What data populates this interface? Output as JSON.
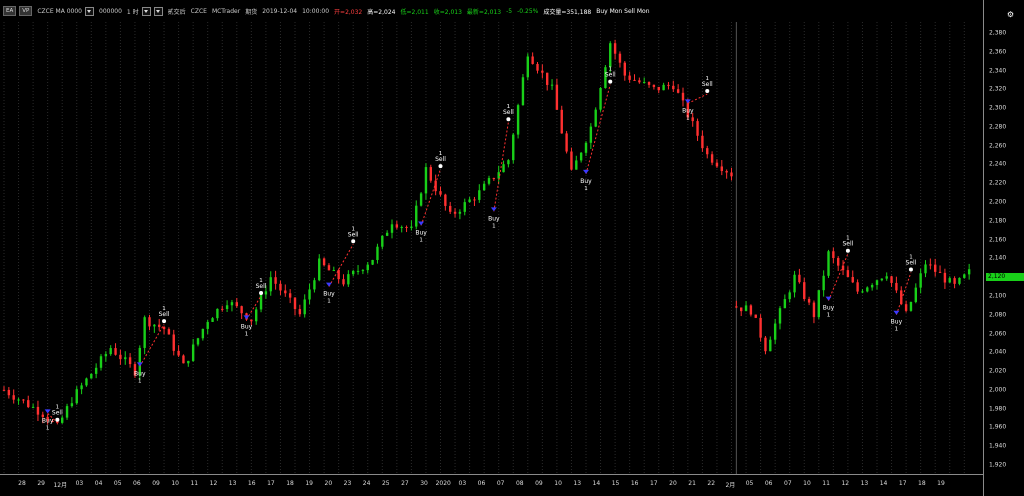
{
  "toolbar": {
    "tab": "EA",
    "vp": "VP",
    "symbol": "CZCE MA 0000",
    "preset": "000000",
    "interval": "1 时",
    "label1": "贰交后",
    "exchange": "CZCE",
    "source": "MCTrader",
    "timeframe": "期货",
    "date": "2019-12-04",
    "time": "10:00:00",
    "open": "开=2,032",
    "high": "高=2,024",
    "low": "低=2,011",
    "close": "收=2,013",
    "change_label": "最新=2,013",
    "change": "-5",
    "pct": "-0.25%",
    "volume": "成交量=351,188",
    "strategy": "Buy Mon Sell Mon"
  },
  "panel": {
    "gear_icon": "⚙",
    "last_price": "2,120"
  },
  "colors": {
    "up": "#19d019",
    "down": "#ff3030",
    "buy": "#3a3aff",
    "sell": "#ffffff"
  },
  "chart_data": {
    "type": "candlestick",
    "y_axis": {
      "ticks": [
        "2,380",
        "2,360",
        "2,340",
        "2,320",
        "2,300",
        "2,280",
        "2,260",
        "2,240",
        "2,220",
        "2,200",
        "2,180",
        "2,160",
        "2,140",
        "2,120",
        "2,100",
        "2,080",
        "2,060",
        "2,040",
        "2,020",
        "2,000",
        "1,980",
        "1,960",
        "1,940",
        "1,920"
      ],
      "range": [
        1910,
        2390
      ]
    },
    "x_axis": {
      "ticks": [
        "28",
        "29",
        "12月",
        "03",
        "04",
        "05",
        "06",
        "09",
        "10",
        "11",
        "12",
        "13",
        "16",
        "17",
        "18",
        "19",
        "20",
        "23",
        "24",
        "25",
        "27",
        "30",
        "2020",
        "03",
        "06",
        "07",
        "08",
        "09",
        "10",
        "13",
        "14",
        "15",
        "16",
        "17",
        "20",
        "21",
        "22",
        "2月",
        "05",
        "06",
        "07",
        "10",
        "11",
        "12",
        "13",
        "14",
        "17",
        "18",
        "19"
      ],
      "bars": 155
    },
    "trend_points": [
      [
        0,
        2000
      ],
      [
        8,
        1975
      ],
      [
        11,
        1960
      ],
      [
        14,
        1990
      ],
      [
        22,
        2045
      ],
      [
        27,
        2020
      ],
      [
        29,
        2075
      ],
      [
        33,
        2065
      ],
      [
        37,
        2025
      ],
      [
        42,
        2075
      ],
      [
        46,
        2095
      ],
      [
        51,
        2075
      ],
      [
        55,
        2120
      ],
      [
        61,
        2080
      ],
      [
        65,
        2135
      ],
      [
        70,
        2115
      ],
      [
        76,
        2140
      ],
      [
        80,
        2180
      ],
      [
        84,
        2170
      ],
      [
        87,
        2235
      ],
      [
        92,
        2185
      ],
      [
        98,
        2210
      ],
      [
        104,
        2245
      ],
      [
        108,
        2360
      ],
      [
        113,
        2320
      ],
      [
        117,
        2230
      ],
      [
        121,
        2280
      ],
      [
        125,
        2370
      ],
      [
        128,
        2335
      ],
      [
        134,
        2320
      ],
      [
        138,
        2325
      ],
      [
        145,
        2250
      ],
      [
        150,
        2230
      ],
      [
        150,
        2090
      ],
      [
        154,
        2085
      ],
      [
        157,
        2045
      ],
      [
        163,
        2120
      ],
      [
        167,
        2080
      ],
      [
        170,
        2145
      ],
      [
        176,
        2105
      ],
      [
        182,
        2125
      ],
      [
        186,
        2080
      ],
      [
        190,
        2135
      ],
      [
        196,
        2110
      ],
      [
        199,
        2125
      ]
    ],
    "signals": [
      {
        "bar": 9,
        "type": "buy",
        "label": "Buy",
        "qty": "1",
        "price": 1975
      },
      {
        "bar": 11,
        "type": "sell",
        "label": "Sell",
        "qty": "1",
        "price": 1965
      },
      {
        "bar": 28,
        "type": "buy",
        "label": "Buy",
        "qty": "1",
        "price": 2025
      },
      {
        "bar": 33,
        "type": "sell",
        "label": "Sell",
        "qty": "1",
        "price": 2070
      },
      {
        "bar": 50,
        "type": "buy",
        "label": "Buy",
        "qty": "1",
        "price": 2075
      },
      {
        "bar": 53,
        "type": "sell",
        "label": "Sell",
        "qty": "1",
        "price": 2100
      },
      {
        "bar": 67,
        "type": "buy",
        "label": "Buy",
        "qty": "1",
        "price": 2110
      },
      {
        "bar": 72,
        "type": "sell",
        "label": "Sell",
        "qty": "1",
        "price": 2155
      },
      {
        "bar": 86,
        "type": "buy",
        "label": "Buy",
        "qty": "1",
        "price": 2175
      },
      {
        "bar": 90,
        "type": "sell",
        "label": "Sell",
        "qty": "1",
        "price": 2235
      },
      {
        "bar": 101,
        "type": "buy",
        "label": "Buy",
        "qty": "1",
        "price": 2190
      },
      {
        "bar": 104,
        "type": "sell",
        "label": "Sell",
        "qty": "1",
        "price": 2285
      },
      {
        "bar": 120,
        "type": "buy",
        "label": "Buy",
        "qty": "1",
        "price": 2230
      },
      {
        "bar": 125,
        "type": "sell",
        "label": "Sell",
        "qty": "1",
        "price": 2325
      },
      {
        "bar": 141,
        "type": "buy",
        "label": "Buy",
        "qty": "1",
        "price": 2305
      },
      {
        "bar": 145,
        "type": "sell",
        "label": "Sell",
        "qty": "1",
        "price": 2315
      },
      {
        "bar": 170,
        "type": "buy",
        "label": "Buy",
        "qty": "1",
        "price": 2095
      },
      {
        "bar": 174,
        "type": "sell",
        "label": "Sell",
        "qty": "1",
        "price": 2145
      },
      {
        "bar": 184,
        "type": "buy",
        "label": "Buy",
        "qty": "1",
        "price": 2080
      },
      {
        "bar": 187,
        "type": "sell",
        "label": "Sell",
        "qty": "1",
        "price": 2125
      }
    ]
  }
}
